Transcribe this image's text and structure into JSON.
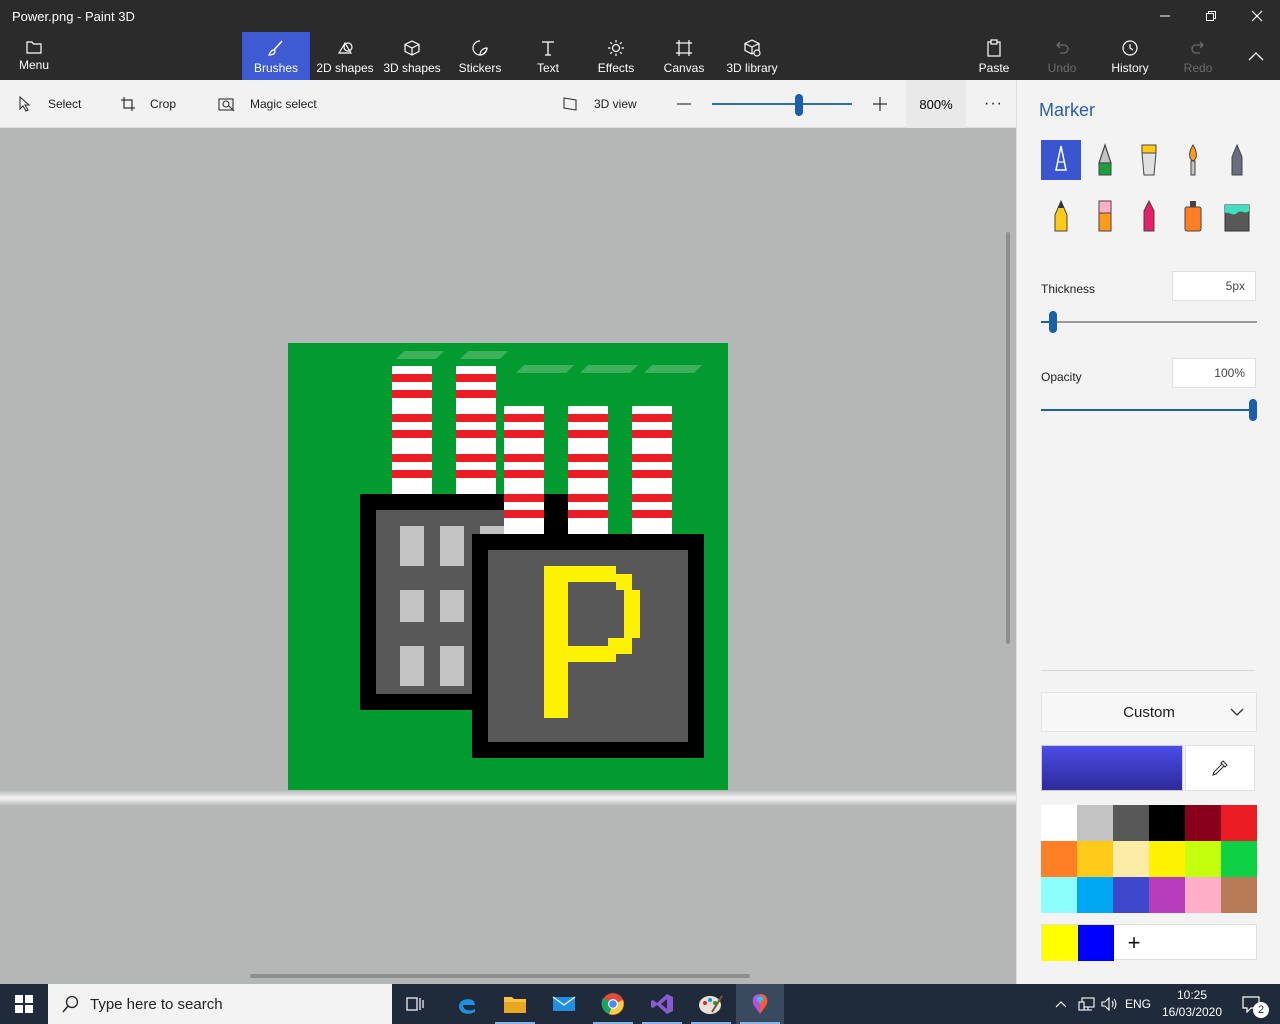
{
  "window": {
    "title": "Power.png - Paint 3D",
    "controls": [
      "minimize",
      "restore",
      "close"
    ]
  },
  "ribbon": {
    "menu_label": "Menu",
    "tools": [
      {
        "label": "Brushes",
        "icon": "brush-icon",
        "active": true
      },
      {
        "label": "2D shapes",
        "icon": "2d-shapes-icon"
      },
      {
        "label": "3D shapes",
        "icon": "3d-cube-icon"
      },
      {
        "label": "Stickers",
        "icon": "sticker-icon"
      },
      {
        "label": "Text",
        "icon": "text-icon"
      },
      {
        "label": "Effects",
        "icon": "sun-icon"
      },
      {
        "label": "Canvas",
        "icon": "canvas-icon"
      },
      {
        "label": "3D library",
        "icon": "3d-library-icon"
      }
    ],
    "paste_label": "Paste",
    "undo_label": "Undo",
    "history_label": "History",
    "redo_label": "Redo"
  },
  "subbar": {
    "select_label": "Select",
    "crop_label": "Crop",
    "magic_select_label": "Magic select",
    "view3d_label": "3D view",
    "zoom_value": "800%",
    "zoom_level_fraction": 0.6,
    "more_label": "···"
  },
  "panel": {
    "title": "Marker",
    "brushes": [
      "marker",
      "calligraphy-pen",
      "oil-brush",
      "watercolor",
      "pixel-pen",
      "pencil",
      "eraser",
      "crayon",
      "spray-can",
      "fill"
    ],
    "selected_brush": "marker",
    "thickness_label": "Thickness",
    "thickness_value": "5px",
    "thickness_fraction": 0.05,
    "opacity_label": "Opacity",
    "opacity_value": "100%",
    "opacity_fraction": 1.0,
    "palette_mode": "Custom",
    "current_color": "#3d3ec4",
    "swatches": [
      "#ffffff",
      "#c3c3c3",
      "#585858",
      "#000000",
      "#88001b",
      "#ec1c24",
      "#ff7f27",
      "#ffca18",
      "#fdeca6",
      "#fff200",
      "#c4ff0e",
      "#0ed145",
      "#8cfffb",
      "#00a8f3",
      "#3f48cc",
      "#b83dba",
      "#ffaec8",
      "#b97a56"
    ],
    "custom_colors": [
      "#ffff00",
      "#0000ff"
    ],
    "add_color_label": "+"
  },
  "artwork": {
    "letter": "P",
    "background_color": "#029b2f"
  },
  "taskbar": {
    "search_placeholder": "Type here to search",
    "apps": [
      "task-view",
      "edge",
      "file-explorer",
      "mail",
      "chrome",
      "visual-studio",
      "paint-palette",
      "paint-3d"
    ],
    "language": "ENG",
    "time": "10:25",
    "date": "16/03/2020",
    "notifications": "2"
  }
}
